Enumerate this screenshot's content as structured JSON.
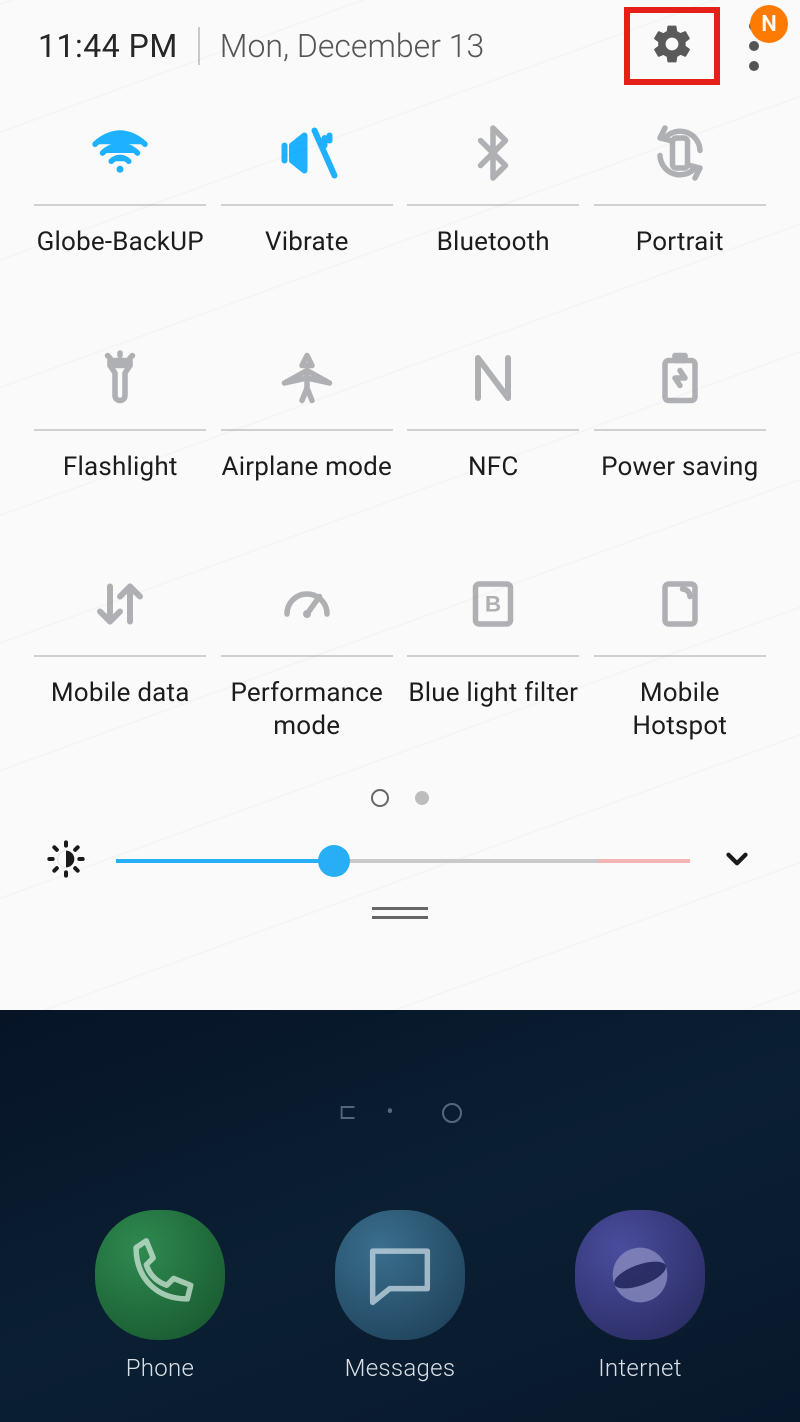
{
  "header": {
    "time": "11:44 PM",
    "date": "Mon, December 13",
    "badge_letter": "N"
  },
  "tiles": [
    {
      "label": "Globe-BackUP"
    },
    {
      "label": "Vibrate"
    },
    {
      "label": "Bluetooth"
    },
    {
      "label": "Portrait"
    },
    {
      "label": "Flashlight"
    },
    {
      "label": "Airplane mode"
    },
    {
      "label": "NFC"
    },
    {
      "label": "Power saving"
    },
    {
      "label": "Mobile data"
    },
    {
      "label": "Performance mode"
    },
    {
      "label": "Blue light filter"
    },
    {
      "label": "Mobile Hotspot"
    }
  ],
  "brightness": {
    "value_pct": 38
  },
  "dock": [
    {
      "label": "Phone"
    },
    {
      "label": "Messages"
    },
    {
      "label": "Internet"
    }
  ]
}
